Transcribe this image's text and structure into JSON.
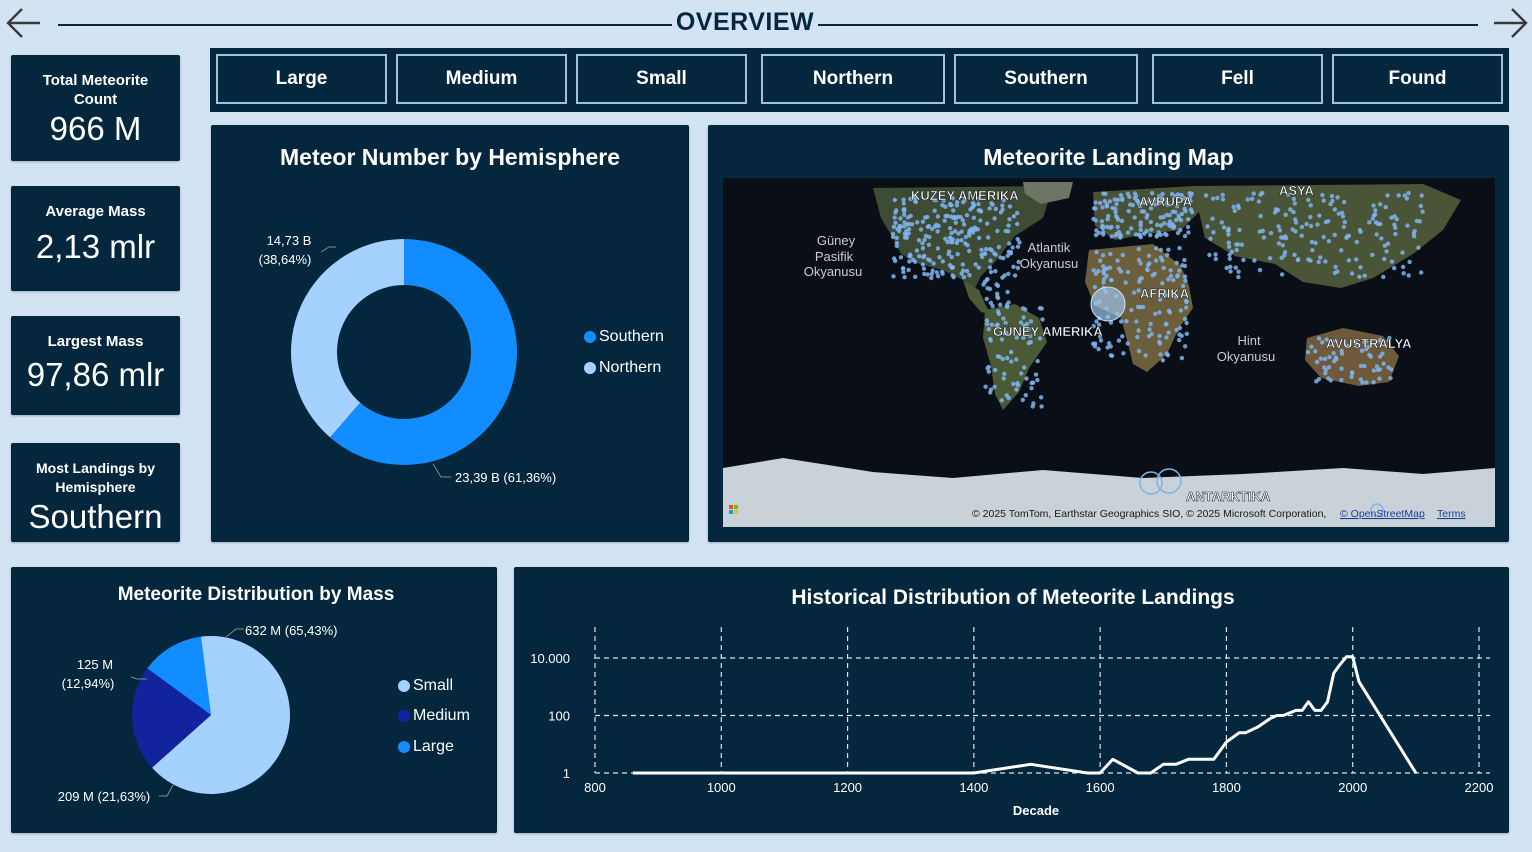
{
  "header": {
    "title": "OVERVIEW",
    "back_icon": "arrow-left-icon",
    "forward_icon": "arrow-right-icon"
  },
  "filters": [
    "Large",
    "Medium",
    "Small",
    "Northern",
    "Southern",
    "Fell",
    "Found"
  ],
  "kpis": [
    {
      "label": "Total Meteorite Count",
      "value": "966 M"
    },
    {
      "label": "Average Mass",
      "value": "2,13 mlr"
    },
    {
      "label": "Largest Mass",
      "value": "97,86 mlr"
    },
    {
      "label": "Most Landings by Hemisphere",
      "value": "Southern"
    }
  ],
  "colors": {
    "background": "#d2e4f4",
    "panel": "#04273d",
    "blue": "#118dff",
    "light_blue": "#a4d1ff",
    "navy": "#12239e"
  },
  "hemisphere_chart": {
    "title": "Meteor Number by Hemisphere",
    "chart_data": {
      "type": "donut",
      "series": [
        {
          "name": "Southern",
          "value": 23.39,
          "label_line1": "23,39 B (61,36%)",
          "label_line2": "",
          "color": "#118dff"
        },
        {
          "name": "Northern",
          "value": 14.73,
          "label_line1": "14,73 B",
          "label_line2": "(38,64%)",
          "color": "#a4d1ff"
        }
      ]
    }
  },
  "map": {
    "title": "Meteorite Landing Map",
    "labels": {
      "north_america": "KUZEY AMERIKA",
      "europe": "AVRUPA",
      "asia": "ASYA",
      "africa": "AFRIKA",
      "south_america": "GÜNEY AMERIKA",
      "australia": "AVUSTRALYA",
      "antarctica": "ANTARKTIKA",
      "atlantic_1": "Atlantik",
      "atlantic_2": "Okyanusu",
      "pacific_1": "Güney",
      "pacific_2": "Pasifik",
      "pacific_3": "Okyanusu",
      "indian_1": "Hint",
      "indian_2": "Okyanusu"
    },
    "attribution": "© 2025 TomTom, Earthstar Geographics SIO, © 2025 Microsoft Corporation,",
    "osm_link": "© OpenStreetMap",
    "terms_link": "Terms",
    "bing_logo": "Microsoft Bing"
  },
  "mass_chart": {
    "title": "Meteorite Distribution by Mass",
    "chart_data": {
      "type": "pie",
      "series": [
        {
          "name": "Small",
          "value": 632,
          "label_line1": "632 M (65,43%)",
          "label_line2": "",
          "color": "#a4d1ff"
        },
        {
          "name": "Medium",
          "value": 209,
          "label_line1": "209 M (21,63%)",
          "label_line2": "",
          "color": "#12239e"
        },
        {
          "name": "Large",
          "value": 125,
          "label_line1": "125 M",
          "label_line2": "(12,94%)",
          "color": "#118dff"
        }
      ]
    }
  },
  "history_chart": {
    "title": "Historical Distribution of Meteorite Landings",
    "chart_data": {
      "type": "line",
      "xlabel": "Decade",
      "ylabel": "",
      "y_scale": "log",
      "xlim": [
        800,
        2200
      ],
      "xticks": [
        800,
        1000,
        1200,
        1400,
        1600,
        1800,
        2000,
        2200
      ],
      "yticks": [
        1,
        100,
        10000
      ],
      "ytick_labels": [
        "1",
        "100",
        "10.000"
      ],
      "grid": true,
      "series": [
        {
          "name": "",
          "color": "#ffffff",
          "x": [
            860,
            1400,
            1490,
            1580,
            1600,
            1620,
            1660,
            1680,
            1700,
            1720,
            1740,
            1760,
            1780,
            1790,
            1800,
            1820,
            1830,
            1850,
            1870,
            1880,
            1890,
            1910,
            1920,
            1930,
            1940,
            1950,
            1960,
            1970,
            1980,
            1990,
            2000,
            2010,
            2100
          ],
          "y": [
            1,
            1,
            2,
            1,
            1,
            3,
            1,
            1,
            2,
            2,
            3,
            3,
            3,
            6,
            12,
            25,
            25,
            40,
            80,
            100,
            100,
            150,
            150,
            300,
            150,
            150,
            300,
            3000,
            6000,
            11000,
            11000,
            1500,
            1
          ]
        }
      ]
    }
  }
}
